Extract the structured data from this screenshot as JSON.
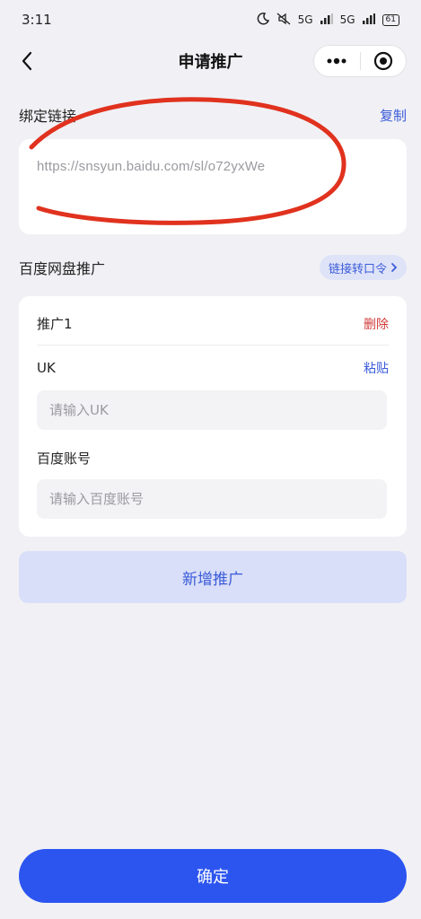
{
  "status_bar": {
    "time": "3:11",
    "signal1": "5G",
    "signal2": "5G",
    "battery": "61"
  },
  "nav": {
    "title": "申请推广"
  },
  "binding": {
    "title": "绑定链接",
    "copy_label": "复制",
    "url": "https://snsyun.baidu.com/sl/o72yxWe"
  },
  "promotion_section": {
    "title": "百度网盘推广",
    "convert_label": "链接转口令"
  },
  "promotion_item": {
    "name": "推广1",
    "delete_label": "删除",
    "uk_label": "UK",
    "paste_label": "粘贴",
    "uk_placeholder": "请输入UK",
    "account_label": "百度账号",
    "account_placeholder": "请输入百度账号"
  },
  "add_button_label": "新增推广",
  "confirm_button_label": "确定",
  "colors": {
    "accent": "#3a5bd9",
    "primary_button": "#2c55f0",
    "delete": "#d23a3a",
    "annotation": "#e0321e"
  },
  "icons": {
    "back": "chevron-left-icon",
    "more": "more-dots-icon",
    "close_mini": "target-circle-icon",
    "moon": "moon-icon",
    "mute": "mute-icon"
  }
}
